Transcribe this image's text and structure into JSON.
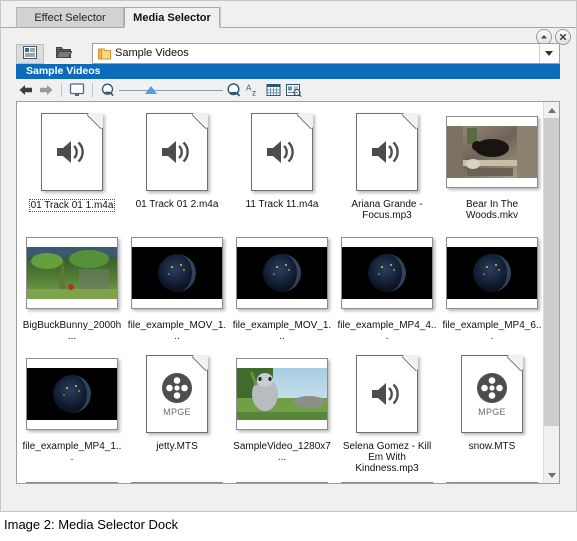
{
  "window": {
    "tabs": [
      {
        "label": "Effect Selector",
        "active": false
      },
      {
        "label": "Media Selector",
        "active": true
      }
    ],
    "collapse_button": "collapse",
    "close_button": "close"
  },
  "addressbar": {
    "details_button": "Details view",
    "folder_button": "Browse folder",
    "folder_icon": "folder-icon",
    "path": "Sample Videos",
    "dropdown": "chevron-down-icon"
  },
  "group_header": {
    "title": "Sample Videos"
  },
  "toolbar": {
    "items": [
      {
        "name": "back-icon",
        "label": "Back"
      },
      {
        "name": "forward-icon",
        "label": "Forward"
      },
      {
        "name": "monitor-icon",
        "label": "Preview"
      },
      {
        "name": "zoom-out-icon",
        "label": "Zoom out"
      },
      {
        "name": "zoom-slider",
        "label": "Thumbnail size"
      },
      {
        "name": "zoom-in-icon",
        "label": "Zoom in"
      },
      {
        "name": "sort-az-icon",
        "label": "Sort A-Z"
      },
      {
        "name": "grid-view-icon",
        "label": "Grid view"
      },
      {
        "name": "detail-view-icon",
        "label": "Detail view"
      }
    ],
    "zoom_value": 25
  },
  "files": [
    {
      "name": "01 Track 01 1.m4a",
      "type": "audio-doc",
      "selected": true
    },
    {
      "name": "01 Track 01 2.m4a",
      "type": "audio-doc",
      "selected": false
    },
    {
      "name": "11 Track 11.m4a",
      "type": "audio-doc",
      "selected": false
    },
    {
      "name": "Ariana Grande - Focus.mp3",
      "type": "audio-doc",
      "selected": false
    },
    {
      "name": "Bear In The Woods.mkv",
      "type": "thumbnail",
      "thumb": "bear-forest",
      "selected": false
    },
    {
      "name": "BigBuckBunny_2000h...",
      "type": "thumbnail",
      "thumb": "green-forest",
      "selected": false
    },
    {
      "name": "file_example_MOV_1...",
      "type": "thumbnail",
      "thumb": "earth-night",
      "selected": false
    },
    {
      "name": "file_example_MOV_1...",
      "type": "thumbnail",
      "thumb": "earth-night",
      "selected": false
    },
    {
      "name": "file_example_MP4_4...",
      "type": "thumbnail",
      "thumb": "earth-night",
      "selected": false
    },
    {
      "name": "file_example_MP4_6...",
      "type": "thumbnail",
      "thumb": "earth-night",
      "selected": false
    },
    {
      "name": "file_example_MP4_1...",
      "type": "thumbnail",
      "thumb": "earth-night",
      "selected": false
    },
    {
      "name": "jetty.MTS",
      "type": "mpge-doc",
      "badge": "MPGE",
      "selected": false
    },
    {
      "name": "SampleVideo_1280x7...",
      "type": "thumbnail",
      "thumb": "bunny-scene",
      "selected": false
    },
    {
      "name": "Selena Gomez - Kill Em With Kindness.mp3",
      "type": "audio-doc",
      "selected": false
    },
    {
      "name": "snow.MTS",
      "type": "mpge-doc",
      "badge": "MPGE",
      "selected": false
    }
  ],
  "partial_row": [
    {
      "thumb": "purple-strip"
    },
    {
      "thumb": "green-strip"
    },
    {
      "thumb": "desert-strip"
    },
    {
      "thumb": "gray-strip"
    },
    {
      "thumb": "mauve-strip"
    }
  ],
  "scrollbar": {
    "up_arrow": "scroll-up-icon",
    "down_arrow": "scroll-down-icon"
  },
  "caption": "Image 2: Media Selector Dock",
  "colors": {
    "group_header_bg": "#0d6cb9",
    "panel_bg": "#f0f0f0",
    "slider_thumb": "#4e9ede"
  }
}
